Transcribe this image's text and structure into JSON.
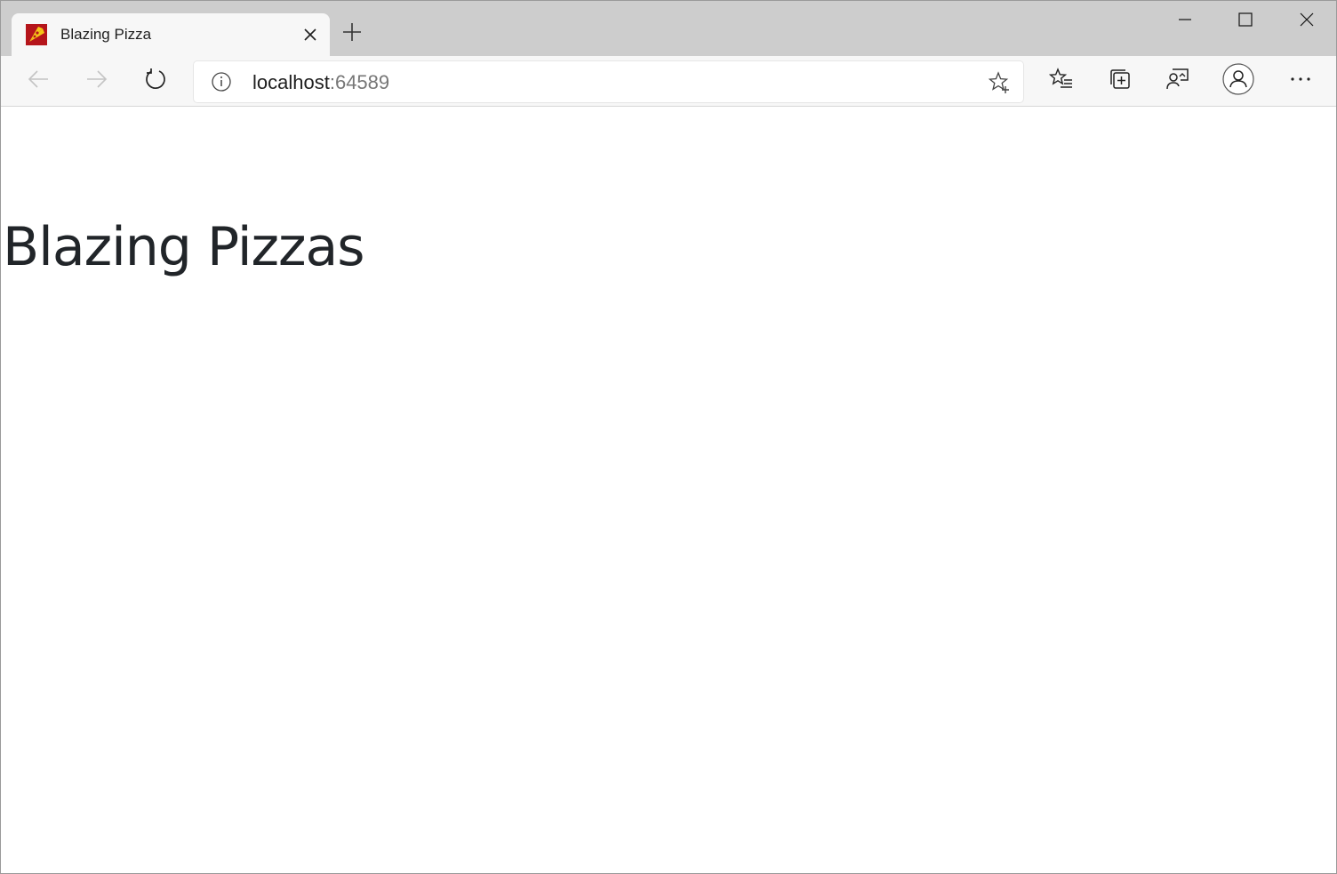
{
  "browser": {
    "tab": {
      "title": "Blazing Pizza"
    },
    "address_bar": {
      "host": "localhost",
      "port": ":64589"
    },
    "icons": {
      "favicon": "pizza-slice-icon",
      "tab_close": "close-icon",
      "new_tab": "plus-icon",
      "minimize": "minimize-icon",
      "maximize": "maximize-icon",
      "window_close": "close-icon",
      "back": "arrow-left-icon",
      "forward": "arrow-right-icon",
      "refresh": "refresh-icon",
      "site_info": "info-icon",
      "add_favorite": "star-plus-icon",
      "favorites": "favorites-list-icon",
      "collections": "collections-icon",
      "feedback": "feedback-icon",
      "profile": "profile-icon",
      "more": "more-icon"
    },
    "colors": {
      "tabstrip": "#cdcdcd",
      "toolbar": "#f7f7f7",
      "favicon_red": "#b5151b",
      "favicon_yellow": "#f5c518"
    }
  },
  "page": {
    "heading": "Blazing Pizzas",
    "text_color": "#212529"
  }
}
